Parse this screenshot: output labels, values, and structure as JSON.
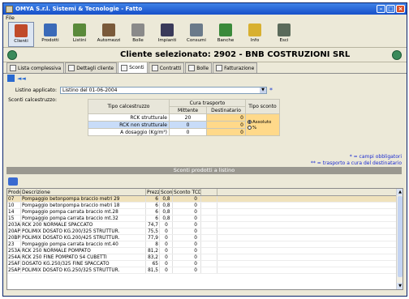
{
  "window": {
    "title": "OMYA S.r.l. Sistemi & Tecnologie - Fatto"
  },
  "menu": {
    "file": "File"
  },
  "toolbar": [
    {
      "label": "Clienti",
      "icon": "clients-icon",
      "color": "#c04a2a",
      "active": true
    },
    {
      "label": "Prodotti",
      "icon": "products-icon",
      "color": "#3a6ab8"
    },
    {
      "label": "Listini",
      "icon": "price-list-icon",
      "color": "#5a8a3a"
    },
    {
      "label": "Automezzi",
      "icon": "truck-icon",
      "color": "#7a5a3a"
    },
    {
      "label": "Bolle",
      "icon": "delivery-note-icon",
      "color": "#8a8a8a"
    },
    {
      "label": "Impianti",
      "icon": "plant-icon",
      "color": "#3a3a5a"
    },
    {
      "label": "Consumi",
      "icon": "consumption-icon",
      "color": "#6a7a8a"
    },
    {
      "label": "Banche",
      "icon": "bank-icon",
      "color": "#3a8a3a"
    },
    {
      "label": "Info",
      "icon": "question-icon",
      "color": "#d8b030"
    },
    {
      "label": "Esci",
      "icon": "exit-icon",
      "color": "#5a6a5a"
    }
  ],
  "header": {
    "title": "Cliente selezionato:   2902 - BNB COSTRUZIONI SRL"
  },
  "tabs": [
    {
      "label": "Lista complessiva",
      "active": false
    },
    {
      "label": "Dettagli cliente",
      "active": false
    },
    {
      "label": "Sconti",
      "active": true
    },
    {
      "label": "Contratti",
      "active": false
    },
    {
      "label": "Bolle",
      "active": false
    },
    {
      "label": "Fatturazione",
      "active": false
    }
  ],
  "nav": {
    "arrows": "◄◄"
  },
  "form": {
    "listino_label": "Listino applicato:",
    "listino_value": "Listino del 01-06-2004",
    "required_mark": "*",
    "sconti_label": "Sconti calcestruzzo:"
  },
  "calc_table": {
    "h_tipo": "Tipo calcestruzzo",
    "h_cura": "Cura trasporto",
    "h_mittente": "Mittente",
    "h_destinatario": "Destinatario",
    "h_sconto": "Tipo sconto",
    "rows": [
      {
        "label": "RCK strutturale",
        "mittente": "20",
        "destinatario": "0"
      },
      {
        "label": "RCK non strutturale",
        "mittente": "0",
        "destinatario": "0"
      },
      {
        "label": "A dosaggio (Kg/m³)",
        "mittente": "0",
        "destinatario": "0"
      }
    ],
    "opt_assoluto": "Assoluto",
    "opt_percent": "%",
    "selected_option": "Assoluto"
  },
  "notes": {
    "line1": "* = campi obbligatori",
    "line2": "** = trasporto a cura del destinatario"
  },
  "section": {
    "title": "Sconti prodotti a listino"
  },
  "list": {
    "headers": [
      "Prodotto",
      "Descrizione",
      "Prezzo",
      "Sconto",
      "Sconto TCD (**)"
    ],
    "rows": [
      [
        "07",
        "Pompaggio betonpompa braccio metri 29",
        "6",
        "0,8",
        "0"
      ],
      [
        "10",
        "Pompaggio betonpompa braccio metri 18",
        "6",
        "0,8",
        "0"
      ],
      [
        "14",
        "Pompaggio pompa carrata braccio mt.28",
        "6",
        "0,8",
        "0"
      ],
      [
        "15",
        "Pompaggio pompa carrata braccio mt.32",
        "6",
        "0,8",
        "0"
      ],
      [
        "203AN",
        "RCK 200 NORMALE SPACCATO",
        "74,7",
        "0",
        "0"
      ],
      [
        "20AP",
        "POLIMIX DOSATO KG.200/325 STRUTTUR.",
        "75,5",
        "0",
        "0"
      ],
      [
        "20BP",
        "POLIMIX DOSATO KG.200/425 STRUTTUR.",
        "77,9",
        "0",
        "0"
      ],
      [
        "23",
        "Pompaggio pompa carrata braccio mt.40",
        "8",
        "0",
        "0"
      ],
      [
        "253AN",
        "RCK 250 NORMALE POMPATO",
        "81,2",
        "0",
        "0"
      ],
      [
        "254AF",
        "RCK 250 FINE POMPATO S4 CUBETTI",
        "83,2",
        "0",
        "0"
      ],
      [
        "25AF",
        "DOSATO KG.250/325 FINE SPACCATO",
        "65",
        "0",
        "0"
      ],
      [
        "25AP",
        "POLIMIX DOSATO KG.250/325 STRUTTUR.",
        "81,5",
        "0",
        "0"
      ]
    ]
  }
}
